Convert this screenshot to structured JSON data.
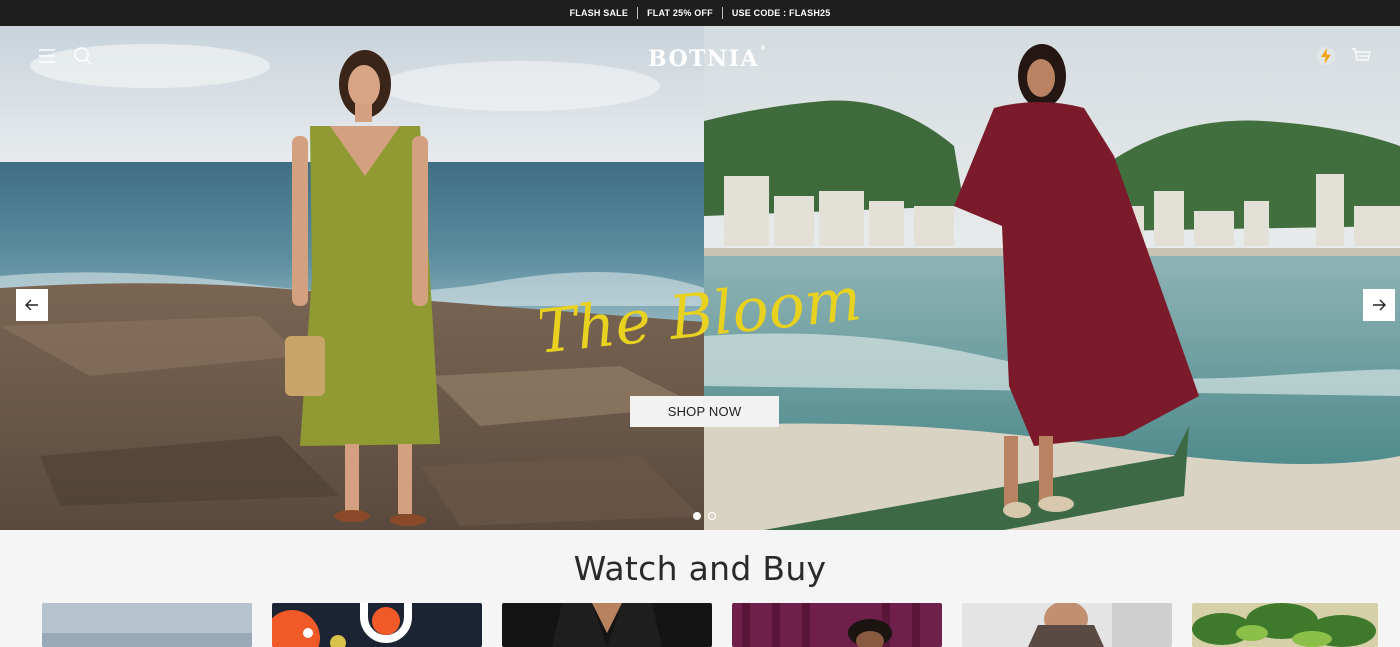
{
  "announcement": {
    "items": [
      "FLASH SALE",
      "FLAT 25% OFF",
      "USE CODE : FLASH25"
    ]
  },
  "header": {
    "brand": "BOTNIA",
    "brand_mark": "®",
    "icons": [
      "menu-icon",
      "search-icon",
      "flash-icon",
      "cart-icon"
    ]
  },
  "hero": {
    "headline": "The Bloom",
    "cta_label": "SHOP NOW",
    "slides_total": 2,
    "active_slide": 1,
    "headline_color": "#e9d21f"
  },
  "section": {
    "title": "Watch and Buy"
  },
  "colors": {
    "announcement_bg": "#1e1e1e",
    "page_bg": "#f5f5f5"
  }
}
